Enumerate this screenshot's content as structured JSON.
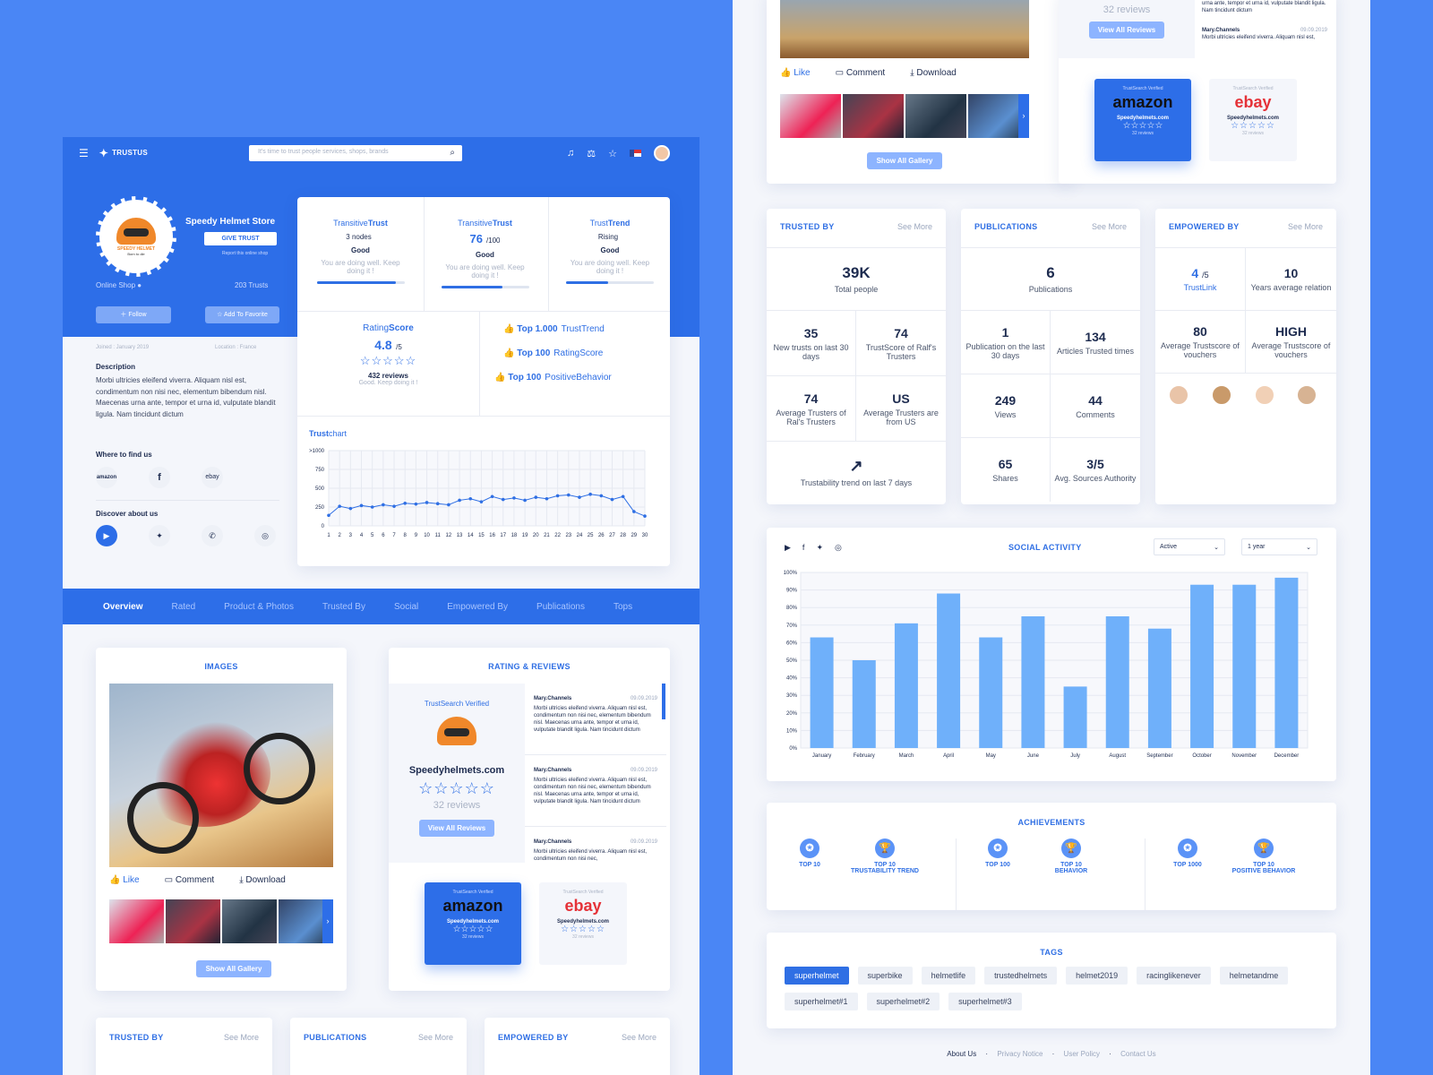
{
  "app": {
    "logo": "TRUSTUS",
    "search_placeholder": "It's time to trust people services, shops, brands"
  },
  "profile": {
    "name": "Speedy Helmet Store",
    "give_trust": "GIVE TRUST",
    "report": "Report this online shop",
    "type": "Online Shop",
    "trusts": "203 Trusts",
    "follow": "Follow",
    "favorite": "Add To Favorite",
    "joined": "Joined : January 2019",
    "location": "Location : France",
    "desc_title": "Description",
    "description": "Morbi ultricies eleifend viverra. Aliquam nisl est, condimentum non nisi nec, elementum bibendum nisl. Maecenas urna ante, tempor et urna id, vulputate blandit ligula. Nam tincidunt dictum",
    "where_title": "Where to find us",
    "discover_title": "Discover about us",
    "logo_name": "SPEEDY HELMET",
    "logo_slogan": "Born to die"
  },
  "trust": {
    "cols": [
      {
        "t1": "Transitive",
        "t2": "Trust",
        "v": "3 nodes",
        "v2": "",
        "g": "Good",
        "n": "You are doing well. Keep doing it !",
        "fill": 0.9
      },
      {
        "t1": "Transitive",
        "t2": "Trust",
        "v": "76",
        "v2": "/100",
        "g": "Good",
        "n": "You are doing well. Keep doing it !",
        "fill": 0.7
      },
      {
        "t1": "Trust",
        "t2": "Trend",
        "v": "Rising",
        "v2": "",
        "g": "Good",
        "n": "You are doing well. Keep doing it !",
        "fill": 0.48
      }
    ],
    "rating": {
      "t1": "Rating",
      "t2": "Score",
      "v": "4.8",
      "of": "/5",
      "reviews": "432 reviews",
      "note": "Good. Keep doing it !"
    },
    "tops": [
      {
        "b": "Top 1.000",
        "r": "TrustTrend"
      },
      {
        "b": "Top 100",
        "r": "RatingScore"
      },
      {
        "b": "Top 100",
        "r": "PositiveBehavior"
      }
    ],
    "chart_title_a": "Trust",
    "chart_title_b": "chart"
  },
  "tabs": [
    "Overview",
    "Rated",
    "Product & Photos",
    "Trusted By",
    "Social",
    "Empowered By",
    "Publications",
    "Tops"
  ],
  "images": {
    "title": "IMAGES",
    "like": "Like",
    "comment": "Comment",
    "download": "Download",
    "show_all": "Show All Gallery"
  },
  "reviews": {
    "title": "RATING & REVIEWS",
    "verified": "TrustSearch Verified",
    "site": "Speedyhelmets.com",
    "count": "32 reviews",
    "view_all": "View All Reviews",
    "items": [
      {
        "name": "Mary.Channels",
        "date": "09.09.2019",
        "text": "Morbi ultricies eleifend viverra. Aliquam nisl est, condimentum non nisi nec, elementum bibendum nisl. Maecenas urna ante, tempor et urna id, vulputate blandit ligula. Nam tincidunt dictum"
      },
      {
        "name": "Mary.Channels",
        "date": "09.09.2019",
        "text": "Morbi ultricies eleifend viverra. Aliquam nisl est, condimentum non nisi nec, elementum bibendum nisl. Maecenas urna ante, tempor et urna id, vulputate blandit ligula. Nam tincidunt dictum"
      },
      {
        "name": "Mary.Channels",
        "date": "09.09.2019",
        "text": "Morbi ultricies eleifend viverra. Aliquam nisl est, condimentum non nisi nec,"
      }
    ],
    "stores": [
      {
        "name": "amazon",
        "site": "Speedyhelmets.com",
        "reviews": "32 reviews",
        "verified": "TrustSearch Verified"
      },
      {
        "name": "ebay",
        "site": "Speedyhelmets.com",
        "reviews": "32 reviews",
        "verified": "TrustSearch Verified"
      }
    ]
  },
  "bottom_cards": [
    {
      "title": "TRUSTED BY",
      "more": "See More"
    },
    {
      "title": "PUBLICATIONS",
      "more": "See More"
    },
    {
      "title": "EMPOWERED BY",
      "more": "See More"
    }
  ],
  "trusted_by": {
    "big": "39K",
    "big_l": "Total people",
    "cells": [
      {
        "v": "35",
        "l": "New trusts on last 30 days"
      },
      {
        "v": "74",
        "l": "TrustScore of Ralf's Trusters"
      },
      {
        "v": "74",
        "l": "Average Trusters of Ral's Trusters"
      },
      {
        "v": "US",
        "l": "Average Trusters are from US"
      }
    ],
    "trend": "Trustability trend on last 7 days"
  },
  "publications": {
    "big": "6",
    "big_l": "Publications",
    "cells": [
      {
        "v": "1",
        "l": "Publication on the last 30 days"
      },
      {
        "v": "134",
        "l": "Articles Trusted times"
      },
      {
        "v": "249",
        "l": "Views"
      },
      {
        "v": "44",
        "l": "Comments"
      },
      {
        "v": "65",
        "l": "Shares"
      },
      {
        "v": "3/5",
        "l": "Avg. Sources Authority"
      }
    ]
  },
  "empowered": {
    "c1v": "4",
    "c1of": "/5",
    "c1l": "TrustLink",
    "c2v": "10",
    "c2l": "Years average relation",
    "c3v": "80",
    "c3l": "Average Trustscore of vouchers",
    "c4v": "HIGH",
    "c4l": "Average Trustscore of vouchers"
  },
  "social": {
    "title": "SOCIAL ACTIVITY",
    "filter1": "Active",
    "filter2": "1 year"
  },
  "achievements": {
    "title": "ACHIEVEMENTS",
    "items": [
      {
        "l1": "TOP 10",
        "l2": ""
      },
      {
        "l1": "TOP 10",
        "l2": "TRUSTABILITY TREND"
      },
      {
        "l1": "TOP 100",
        "l2": ""
      },
      {
        "l1": "TOP 10",
        "l2": "BEHAVIOR"
      },
      {
        "l1": "TOP 1000",
        "l2": ""
      },
      {
        "l1": "TOP 10",
        "l2": "POSITIVE BEHAVIOR"
      }
    ]
  },
  "tags": {
    "title": "TAGS",
    "items": [
      "superhelmet",
      "superbike",
      "helmetlife",
      "trustedhelmets",
      "helmet2019",
      "racinglikenever",
      "helmetandme",
      "superhelmet#1",
      "superhelmet#2",
      "superhelmet#3"
    ]
  },
  "footer": [
    "About Us",
    "Privacy Notice",
    "User Policy",
    "Contact Us"
  ],
  "right_top": {
    "reviews": "32 reviews",
    "view_all": "View All Reviews",
    "rev_name": "Mary.Channels",
    "rev_date": "09.09.2019",
    "rev_text": "urna ante, tempor et urna id, vulputate blandit ligula. Nam tincidunt dictum",
    "rev_text2": "Morbi ultricies eleifend viverra. Aliquam nisl est,"
  },
  "chart_data": [
    {
      "type": "line",
      "title": "Trustchart",
      "x": [
        1,
        2,
        3,
        4,
        5,
        6,
        7,
        8,
        9,
        10,
        11,
        12,
        13,
        14,
        15,
        16,
        17,
        18,
        19,
        20,
        21,
        22,
        23,
        24,
        25,
        26,
        27,
        28,
        29,
        30
      ],
      "y": [
        140,
        260,
        230,
        270,
        250,
        280,
        260,
        300,
        290,
        310,
        295,
        280,
        340,
        360,
        320,
        390,
        350,
        370,
        340,
        380,
        360,
        400,
        410,
        380,
        420,
        400,
        350,
        390,
        190,
        130
      ],
      "ylim": [
        0,
        1000
      ],
      "yticks": [
        "0",
        "250",
        "500",
        "750",
        ">1000"
      ]
    },
    {
      "type": "bar",
      "title": "SOCIAL ACTIVITY",
      "categories": [
        "January",
        "February",
        "March",
        "April",
        "May",
        "June",
        "July",
        "August",
        "September",
        "October",
        "November",
        "December"
      ],
      "values": [
        63,
        50,
        71,
        88,
        63,
        75,
        35,
        75,
        68,
        93,
        93,
        97
      ],
      "ylim": [
        0,
        100
      ],
      "yticks": [
        "0%",
        "10%",
        "20%",
        "30%",
        "40%",
        "50%",
        "60%",
        "70%",
        "80%",
        "90%",
        "100%"
      ]
    }
  ]
}
